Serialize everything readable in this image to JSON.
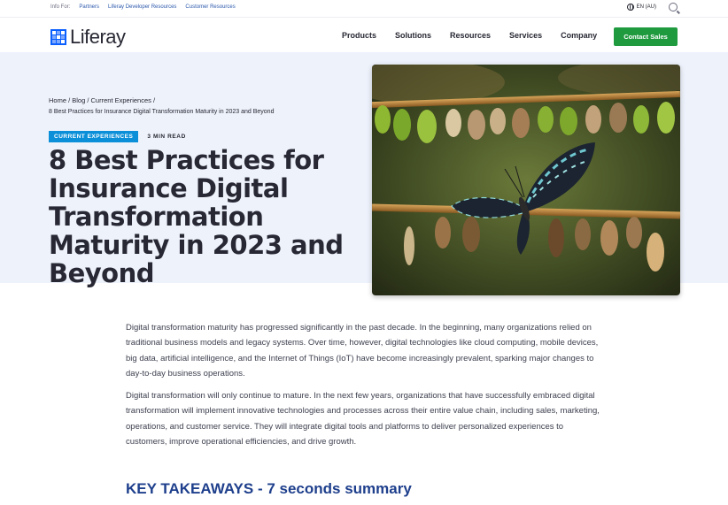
{
  "utility": {
    "info_for": "Info For:",
    "links": [
      "Partners",
      "Liferay Developer Resources",
      "Customer Resources"
    ],
    "language": "EN (AU)"
  },
  "nav": {
    "logo_text": "Liferay",
    "items": [
      "Products",
      "Solutions",
      "Resources",
      "Services",
      "Company"
    ],
    "cta": "Contact Sales"
  },
  "breadcrumb": {
    "trail": "Home / Blog / Current Experiences /",
    "current": "8 Best Practices for Insurance Digital Transformation Maturity in 2023 and Beyond"
  },
  "hero": {
    "tag": "CURRENT EXPERIENCES",
    "read_time": "3 MIN READ",
    "title": "8 Best Practices for Insurance Digital Transformation Maturity in 2023 and Beyond"
  },
  "article": {
    "paragraphs": [
      "Digital transformation maturity has progressed significantly in the past decade. In the beginning, many organizations relied on traditional business models and legacy systems. Over time, however, digital technologies like cloud computing, mobile devices, big data, artificial intelligence, and the Internet of Things (IoT) have become increasingly prevalent, sparking major changes to day-to-day business operations.",
      "Digital transformation will only continue to mature. In the next few years, organizations that have successfully embraced digital transformation will implement innovative technologies and processes across their entire value chain, including sales, marketing, operations, and customer service. They will integrate digital tools and platforms to deliver personalized experiences to customers, improve operational efficiencies, and drive growth."
    ],
    "section_heading": "KEY TAKEAWAYS - 7 seconds summary"
  },
  "colors": {
    "brand_blue": "#0b5fff",
    "cta_green": "#1f9a3e",
    "hero_bg": "#eef2fb",
    "tag_blue": "#0b8fd8",
    "heading_blue": "#1e3f8c"
  }
}
